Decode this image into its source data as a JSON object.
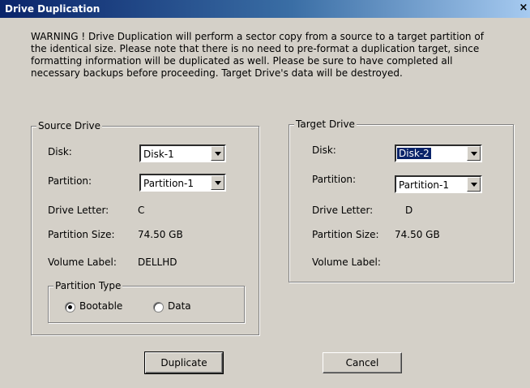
{
  "window": {
    "title": "Drive Duplication",
    "close_glyph": "×"
  },
  "warning": "WARNING !  Drive Duplication will perform a sector copy from a source to a target partition of the identical size.  Please note that there is no need to pre-format a duplication target, since formatting information will be duplicated as well.  Please be sure to have completed all necessary backups before proceeding. Target Drive's data will be destroyed.",
  "source": {
    "group_label": "Source Drive",
    "disk_label": "Disk:",
    "disk_value": "Disk-1",
    "partition_label": "Partition:",
    "partition_value": "Partition-1",
    "letter_label": "Drive Letter:",
    "letter_value": "C",
    "size_label": "Partition Size:",
    "size_value": "74.50 GB",
    "volume_label": "Volume Label:",
    "volume_value": "DELLHD",
    "ptype": {
      "group_label": "Partition Type",
      "bootable": "Bootable",
      "data": "Data",
      "selected": "Bootable"
    }
  },
  "target": {
    "group_label": "Target Drive",
    "disk_label": "Disk:",
    "disk_value": "Disk-2",
    "partition_label": "Partition:",
    "partition_value": "Partition-1",
    "letter_label": "Drive Letter:",
    "letter_value": "D",
    "size_label": "Partition Size:",
    "size_value": "74.50 GB",
    "volume_label": "Volume Label:",
    "volume_value": ""
  },
  "buttons": {
    "duplicate": "Duplicate",
    "cancel": "Cancel"
  }
}
